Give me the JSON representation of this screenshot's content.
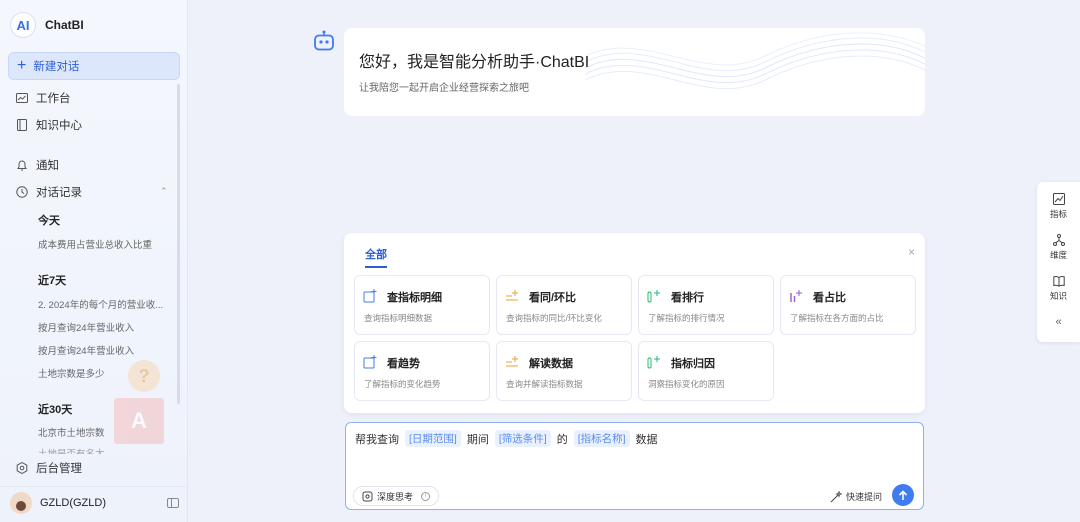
{
  "brand": {
    "logo": "AI",
    "name": "ChatBI"
  },
  "sidebar": {
    "new_chat": "新建对话",
    "items": [
      {
        "label": "工作台",
        "icon": "dashboard-icon"
      },
      {
        "label": "知识中心",
        "icon": "book-icon"
      },
      {
        "label": "通知",
        "icon": "bell-icon"
      },
      {
        "label": "对话记录",
        "icon": "clock-icon"
      }
    ],
    "history": [
      {
        "title": "今天",
        "entries": [
          "成本费用占营业总收入比重"
        ]
      },
      {
        "title": "近7天",
        "entries": [
          "2. 2024年的每个月的营业收...",
          "按月查询24年营业收入",
          "按月查询24年营业收入",
          "土地宗数是多少"
        ]
      },
      {
        "title": "近30天",
        "entries": [
          "北京市土地宗数",
          "土地是否有名太"
        ]
      }
    ],
    "admin": "后台管理",
    "user": "GZLD(GZLD)"
  },
  "welcome": {
    "title": "您好，我是智能分析助手·ChatBI",
    "subtitle": "让我陪您一起开启企业经营探索之旅吧"
  },
  "skills": {
    "tab": "全部",
    "close": "×",
    "cards": [
      {
        "title": "查指标明细",
        "desc": "查询指标明细数据",
        "color": "#3f7cf0"
      },
      {
        "title": "看同/环比",
        "desc": "查询指标的同比/环比变化",
        "color": "#e6a23c"
      },
      {
        "title": "看排行",
        "desc": "了解指标的排行情况",
        "color": "#2bb673"
      },
      {
        "title": "看占比",
        "desc": "了解指标在各方面的占比",
        "color": "#9b59d0"
      },
      {
        "title": "看趋势",
        "desc": "了解指标的变化趋势",
        "color": "#3f7cf0"
      },
      {
        "title": "解读数据",
        "desc": "查询并解读指标数据",
        "color": "#e6a23c"
      },
      {
        "title": "指标归因",
        "desc": "洞察指标变化的原因",
        "color": "#2bb673"
      }
    ]
  },
  "composer": {
    "prefix": "帮我查询",
    "slot1": "[日期范围]",
    "word1": "期间",
    "slot2": "[筛选条件]",
    "word2": "的",
    "slot3": "[指标名称]",
    "suffix": "数据",
    "deep_think": "深度思考",
    "quick_ask": "快速提问"
  },
  "rail": {
    "items": [
      "指标",
      "维度",
      "知识"
    ],
    "collapse": "«"
  }
}
